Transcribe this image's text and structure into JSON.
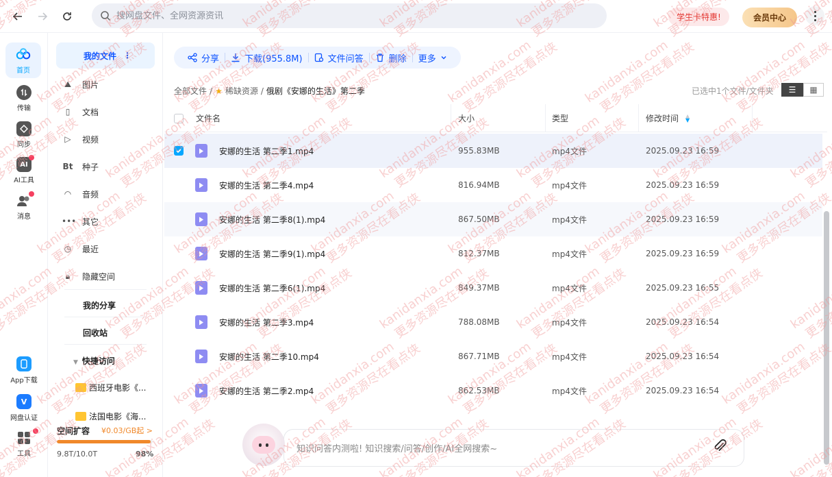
{
  "topbar": {
    "search_placeholder": "搜网盘文件、全网资源资讯",
    "promo_label": "学生卡特惠!",
    "vip_label": "会员中心"
  },
  "rail": {
    "items": [
      {
        "label": "首页",
        "icon": "home-icon"
      },
      {
        "label": "传输",
        "icon": "transfer-icon"
      },
      {
        "label": "同步",
        "icon": "sync-icon"
      },
      {
        "label": "AI工具",
        "icon": "ai-icon"
      },
      {
        "label": "消息",
        "icon": "message-icon"
      }
    ],
    "bottom": [
      {
        "label": "App下载",
        "icon": "phone-icon"
      },
      {
        "label": "网盘认证",
        "icon": "verify-icon"
      },
      {
        "label": "工具",
        "icon": "tools-icon"
      }
    ]
  },
  "side": {
    "head": "我的文件",
    "items": [
      "图片",
      "文档",
      "视频",
      "种子",
      "音频",
      "其它",
      "最近",
      "隐藏空间"
    ],
    "my_share": "我的分享",
    "recycle": "回收站",
    "quick_access": "快捷访问",
    "quick_items": [
      "西班牙电影《...",
      "法国电影《海..."
    ],
    "storage": {
      "title": "空间扩容",
      "price": "¥0.03/GB起 >",
      "used": "9.8T/10.0T",
      "percent": "98%",
      "fill": 0.98
    }
  },
  "toolbar": {
    "share": "分享",
    "download": "下载(955.8M)",
    "file_qa": "文件问答",
    "delete": "删除",
    "more": "更多"
  },
  "breadcrumb": {
    "root": "全部文件",
    "mid": "稀缺资源",
    "current": "俄剧《安娜的生活》第二季",
    "selected_info": "已选中1个文件/文件夹"
  },
  "table": {
    "headers": {
      "name": "文件名",
      "size": "大小",
      "type": "类型",
      "modified": "修改时间"
    },
    "rows": [
      {
        "name": "安娜的生活 第二季1.mp4",
        "size": "955.83MB",
        "type": "mp4文件",
        "modified": "2025.09.23 16:59",
        "checked": true
      },
      {
        "name": "安娜的生活 第二季4.mp4",
        "size": "816.94MB",
        "type": "mp4文件",
        "modified": "2025.09.23 16:59",
        "checked": false
      },
      {
        "name": "安娜的生活 第二季8(1).mp4",
        "size": "867.50MB",
        "type": "mp4文件",
        "modified": "2025.09.23 16:59",
        "checked": false
      },
      {
        "name": "安娜的生活 第二季9(1).mp4",
        "size": "812.37MB",
        "type": "mp4文件",
        "modified": "2025.09.23 16:59",
        "checked": false
      },
      {
        "name": "安娜的生活 第二季6(1).mp4",
        "size": "849.37MB",
        "type": "mp4文件",
        "modified": "2025.09.23 16:55",
        "checked": false
      },
      {
        "name": "安娜的生活 第二季3.mp4",
        "size": "788.08MB",
        "type": "mp4文件",
        "modified": "2025.09.23 16:54",
        "checked": false
      },
      {
        "name": "安娜的生活 第二季10.mp4",
        "size": "867.71MB",
        "type": "mp4文件",
        "modified": "2025.09.23 16:54",
        "checked": false
      },
      {
        "name": "安娜的生活 第二季2.mp4",
        "size": "862.53MB",
        "type": "mp4文件",
        "modified": "2025.09.23 16:54",
        "checked": false
      }
    ]
  },
  "ai": {
    "placeholder": "知识问答内测啦! 知识搜索/问答/创作/AI全网搜索~"
  },
  "watermark": {
    "text_a": "kanidanxia.com",
    "text_b": "更多资源尽在看点侠"
  },
  "colors": {
    "accent": "#06a7ff",
    "brand_blue": "#0d53ff",
    "video_icon": "#8e8cf2",
    "storage": "#f0882a",
    "notify_dot": "#f54060"
  }
}
